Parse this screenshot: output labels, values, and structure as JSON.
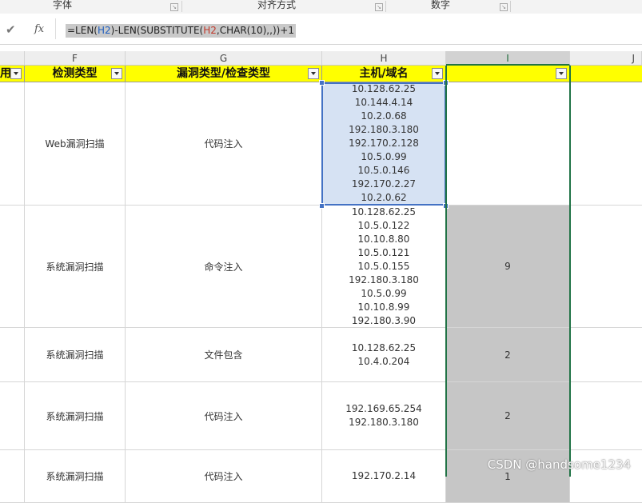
{
  "ribbon": {
    "groups": [
      "字体",
      "对齐方式",
      "数字"
    ]
  },
  "formula_bar": {
    "check_icon": "checkmark-icon",
    "fx_label": "fx",
    "formula": {
      "p1": "=LEN(",
      "p2": "H2",
      "p3": ")-LEN(SUBSTITUTE(",
      "p4": "H2",
      "p5": ",CHAR(10),",
      "p6": ",",
      "p7": "))+1"
    }
  },
  "columns": [
    "F",
    "G",
    "H",
    "I",
    "J"
  ],
  "header_row": {
    "e_partial": "用",
    "f": "检测类型",
    "g": "漏洞类型/检查类型",
    "h": "主机/域名",
    "i": ""
  },
  "rows": [
    {
      "f": "Web漏洞扫描",
      "g": "代码注入",
      "h": [
        "10.128.62.25",
        "10.144.4.14",
        "10.2.0.68",
        "192.180.3.180",
        "192.170.2.128",
        "10.5.0.99",
        "10.5.0.146",
        "192.170.2.27",
        "10.2.0.62"
      ],
      "i": ""
    },
    {
      "f": "系统漏洞扫描",
      "g": "命令注入",
      "h": [
        "10.128.62.25",
        "10.5.0.122",
        "10.10.8.80",
        "10.5.0.121",
        "10.5.0.155",
        "192.180.3.180",
        "10.5.0.99",
        "10.10.8.99",
        "192.180.3.90"
      ],
      "i": "9"
    },
    {
      "f": "系统漏洞扫描",
      "g": "文件包含",
      "h": [
        "10.128.62.25",
        "10.4.0.204"
      ],
      "i": "2"
    },
    {
      "f": "系统漏洞扫描",
      "g": "代码注入",
      "h": [
        "192.169.65.254",
        "192.180.3.180"
      ],
      "i": "2"
    },
    {
      "f": "系统漏洞扫描",
      "g": "代码注入",
      "h": [
        "192.170.2.14"
      ],
      "i": "1"
    }
  ],
  "watermark": "CSDN @handsome1234",
  "colors": {
    "header_fill": "#ffff00",
    "selection_blue": "#4472c4",
    "active_column_green": "#217346",
    "formula_highlight": "#c9c9c9"
  }
}
